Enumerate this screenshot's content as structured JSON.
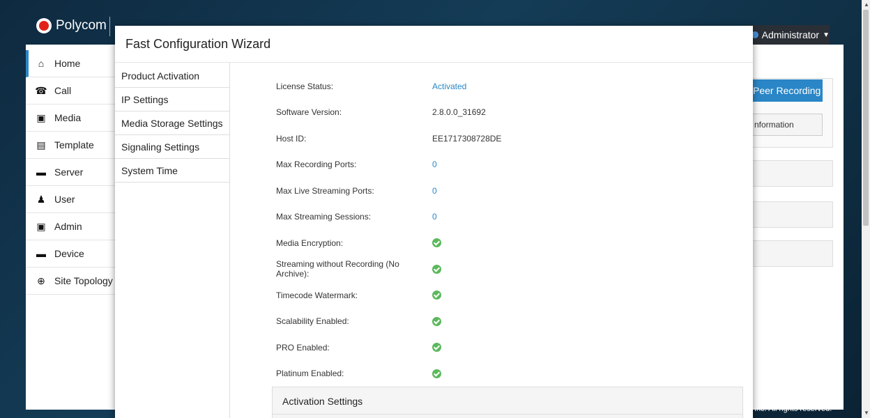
{
  "app": {
    "logo_text": "Polycom",
    "user_menu": "Administrator"
  },
  "sidebar": {
    "items": [
      {
        "label": "Home",
        "icon": "home-icon"
      },
      {
        "label": "Call",
        "icon": "phone-icon"
      },
      {
        "label": "Media",
        "icon": "film-icon"
      },
      {
        "label": "Template",
        "icon": "template-icon"
      },
      {
        "label": "Server",
        "icon": "server-icon"
      },
      {
        "label": "User",
        "icon": "user-icon"
      },
      {
        "label": "Admin",
        "icon": "admin-icon"
      },
      {
        "label": "Device",
        "icon": "device-icon"
      },
      {
        "label": "Site Topology",
        "icon": "globe-icon"
      }
    ]
  },
  "background": {
    "peer_button": "Peer Recording",
    "info_button": "nformation",
    "copyright": "Inc. All rights reserved."
  },
  "modal": {
    "title": "Fast Configuration Wizard",
    "nav": [
      "Product Activation",
      "IP Settings",
      "Media Storage Settings",
      "Signaling Settings",
      "System Time"
    ],
    "rows": [
      {
        "label": "License Status:",
        "value": "Activated",
        "kind": "link"
      },
      {
        "label": "Software Version:",
        "value": "2.8.0.0_31692",
        "kind": "text"
      },
      {
        "label": "Host ID:",
        "value": "EE1717308728DE",
        "kind": "text"
      },
      {
        "label": "Max Recording Ports:",
        "value": "0",
        "kind": "link"
      },
      {
        "label": "Max Live Streaming Ports:",
        "value": "0",
        "kind": "link"
      },
      {
        "label": "Max Streaming Sessions:",
        "value": "0",
        "kind": "link"
      },
      {
        "label": "Media Encryption:",
        "value": "",
        "kind": "check"
      },
      {
        "label": "Streaming without Recording (No Archive):",
        "value": "",
        "kind": "check"
      },
      {
        "label": "Timecode Watermark:",
        "value": "",
        "kind": "check"
      },
      {
        "label": "Scalability Enabled:",
        "value": "",
        "kind": "check"
      },
      {
        "label": "PRO Enabled:",
        "value": "",
        "kind": "check"
      },
      {
        "label": "Platinum Enabled:",
        "value": "",
        "kind": "check"
      }
    ],
    "activation_settings": "Activation Settings"
  },
  "colors": {
    "accent": "#2a86c6",
    "check": "#5cb85c"
  }
}
